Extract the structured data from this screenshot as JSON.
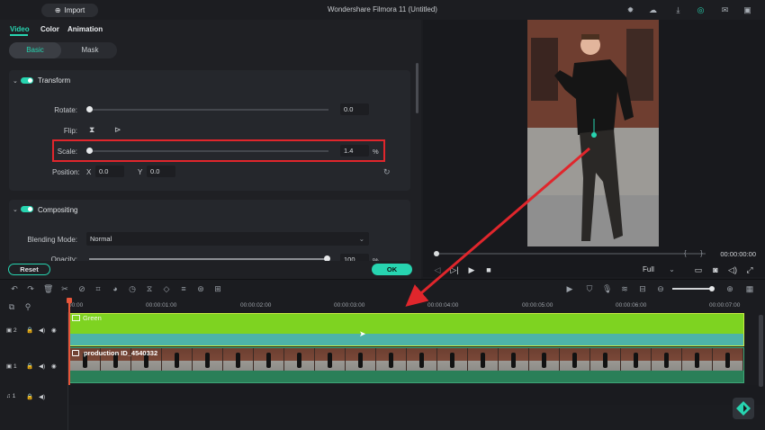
{
  "app": {
    "title": "Wondershare Filmora 11 (Untitled)",
    "import_label": "Import"
  },
  "tabs": [
    "Video",
    "Color",
    "Animation"
  ],
  "subtabs": [
    "Basic",
    "Mask"
  ],
  "transform": {
    "heading": "Transform",
    "rotate_label": "Rotate:",
    "rotate_value": "0.0",
    "flip_label": "Flip:",
    "scale_label": "Scale:",
    "scale_value": "1.4",
    "scale_unit": "%",
    "position_label": "Position:",
    "pos_x_label": "X",
    "pos_x_value": "0.0",
    "pos_y_label": "Y",
    "pos_y_value": "0.0"
  },
  "compositing": {
    "heading": "Compositing",
    "blend_label": "Blending Mode:",
    "blend_value": "Normal",
    "opacity_label": "Opacity:",
    "opacity_value": "100",
    "opacity_unit": "%"
  },
  "buttons": {
    "reset": "Reset",
    "ok": "OK"
  },
  "player": {
    "timecode": "00:00:00:00",
    "quality": "Full"
  },
  "ruler": [
    "00:00",
    "00:00:01:00",
    "00:00:02:00",
    "00:00:03:00",
    "00:00:04:00",
    "00:00:05:00",
    "00:00:06:00",
    "00:00:07:00"
  ],
  "tracks": {
    "track2": {
      "index": "2",
      "clip_label": "Green"
    },
    "track1": {
      "index": "1",
      "clip_label": "production ID_4540332"
    },
    "audio1": {
      "index": "1"
    }
  },
  "colors": {
    "accent": "#27d4b0",
    "green_clip": "#7ed321",
    "highlight": "#e0262c"
  }
}
